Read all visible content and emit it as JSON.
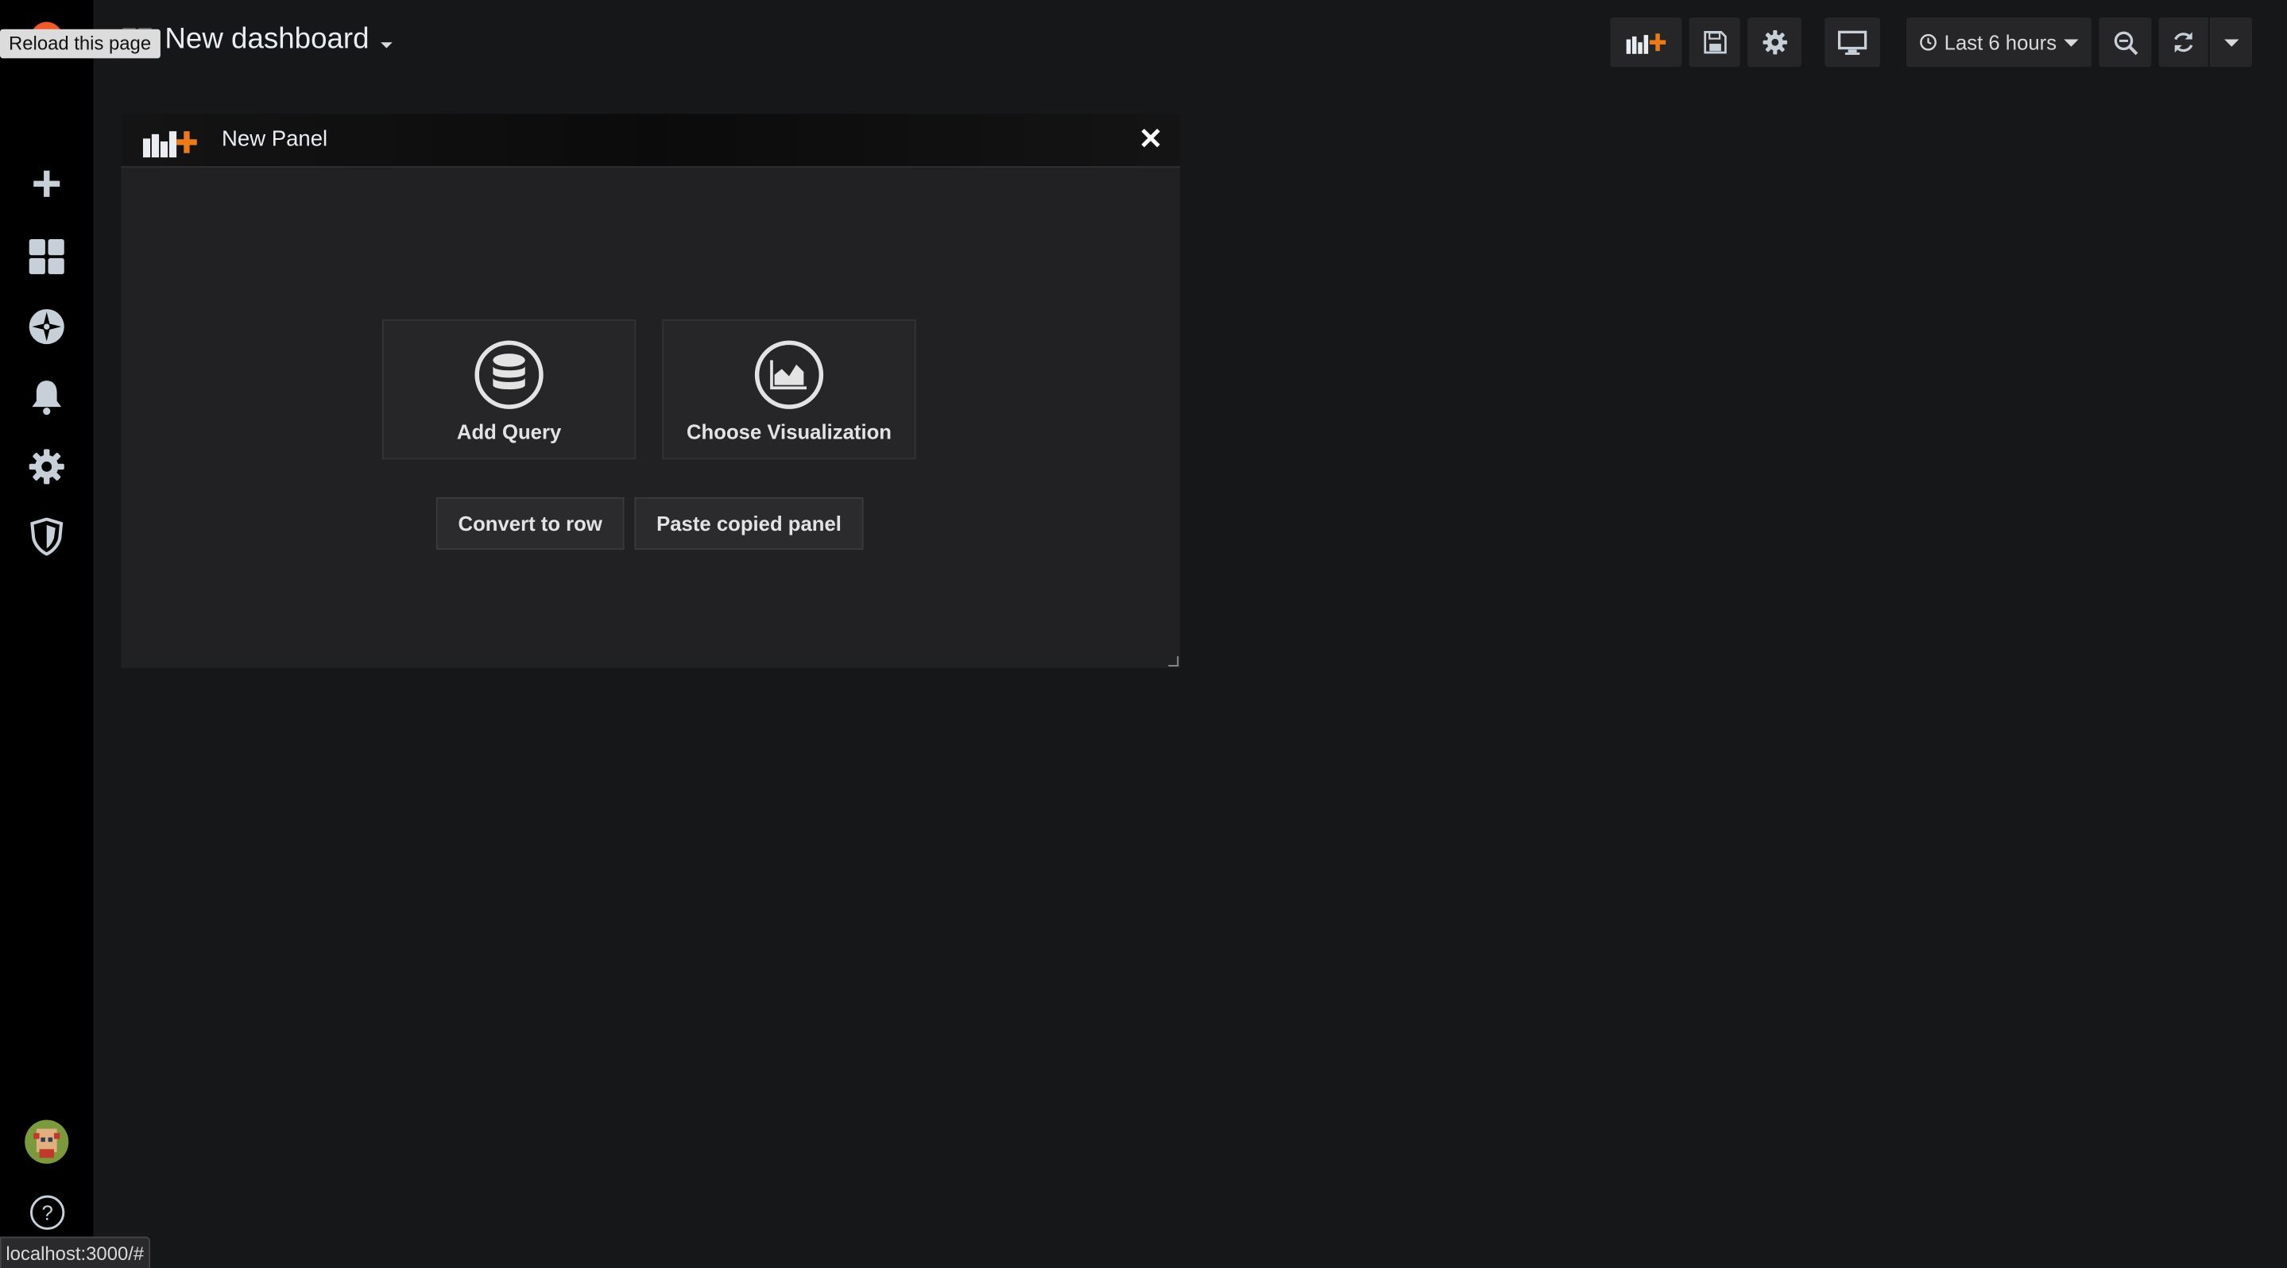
{
  "tooltip": {
    "text": "Reload this page"
  },
  "header": {
    "dashboard_title": "New dashboard",
    "time_range": "Last 6 hours"
  },
  "panel": {
    "title": "New Panel",
    "close_symbol": "✕",
    "add_query_label": "Add Query",
    "choose_visualization_label": "Choose Visualization",
    "convert_to_row_label": "Convert to row",
    "paste_copied_panel_label": "Paste copied panel"
  },
  "sidebar": {
    "items": [
      {
        "icon": "plus-icon"
      },
      {
        "icon": "dashboards-icon"
      },
      {
        "icon": "explore-compass-icon"
      },
      {
        "icon": "alerting-bell-icon"
      },
      {
        "icon": "configuration-gear-icon"
      },
      {
        "icon": "server-admin-shield-icon"
      }
    ]
  },
  "status_bar": {
    "url": "localhost:3000/#"
  },
  "colors": {
    "background": "#161719",
    "sidebar": "#000000",
    "panel": "#212124",
    "accent_orange": "#eb7b18"
  }
}
